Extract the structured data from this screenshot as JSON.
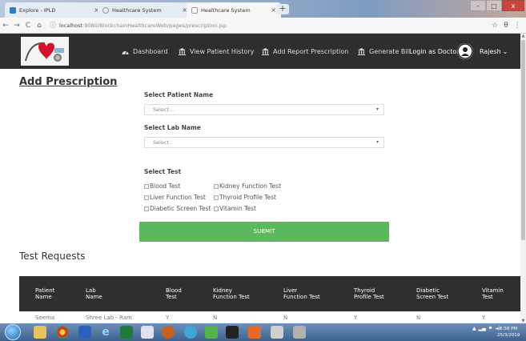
{
  "browser": {
    "tabs": [
      {
        "title": "Explore - IPLD",
        "close": "×"
      },
      {
        "title": "Healthcare System",
        "close": "×"
      },
      {
        "title": "Healthcare System",
        "close": "×"
      }
    ],
    "new_tab": "+",
    "window_buttons": [
      "–",
      "□",
      "x"
    ],
    "url_host": "localhost",
    "url_path": ":9080/BlockchainHealthcareWeb/pages/prescription.jsp",
    "nav": {
      "back": "←",
      "forward": "→",
      "reload": "C",
      "home": "⌂",
      "info": "ⓘ"
    },
    "right_icons": {
      "star": "☆",
      "account": "θ",
      "menu": "⋮"
    }
  },
  "navbar": {
    "items": [
      {
        "label": "Dashboard",
        "icon": "dashboard-icon"
      },
      {
        "label": "View Patient History",
        "icon": "bank-icon"
      },
      {
        "label": "Add Report Prescription",
        "icon": "bank-icon"
      },
      {
        "label": "Generate Bill",
        "icon": "bank-icon"
      }
    ],
    "login_as": "Login as Doctor",
    "user": "Rajesh",
    "user_caret": "⌄"
  },
  "form": {
    "title": "Add Prescription",
    "patient_label": "Select Patient Name",
    "patient_value": "Select...",
    "lab_label": "Select Lab Name",
    "lab_value": "Select..",
    "caret": "▾",
    "test_label": "Select Test",
    "tests": [
      "Blood Test",
      "Kidney Function Test",
      "Liver Function Test",
      "Thyroid Profile Test",
      "Diabetic Screen Test",
      "Vitamin Test"
    ],
    "submit": "SUBMIT"
  },
  "requests": {
    "title": "Test Requests",
    "columns": [
      [
        "Patient",
        "Name"
      ],
      [
        "Lab",
        "Name"
      ],
      [
        "Blood",
        "Test"
      ],
      [
        "Kidney",
        "Function Test"
      ],
      [
        "Liver",
        "Function Test"
      ],
      [
        "Thyroid",
        "Profile Test"
      ],
      [
        "Diabetic",
        "Screen Test"
      ],
      [
        "Vitamin",
        "Test"
      ]
    ],
    "rows": [
      [
        "Seema",
        "Shree Lab - Ram",
        "Y",
        "N",
        "N",
        "Y",
        "N",
        "Y"
      ]
    ]
  },
  "taskbar": {
    "tray": [
      "▲",
      "▂▄",
      "⚑",
      "◄)",
      "⚐"
    ],
    "time": "6:58 PM",
    "date": "25/3/2019"
  },
  "colors": {
    "navbar": "#2e2e2e",
    "submit": "#5cb85c",
    "table_header": "#2f2f2f"
  }
}
